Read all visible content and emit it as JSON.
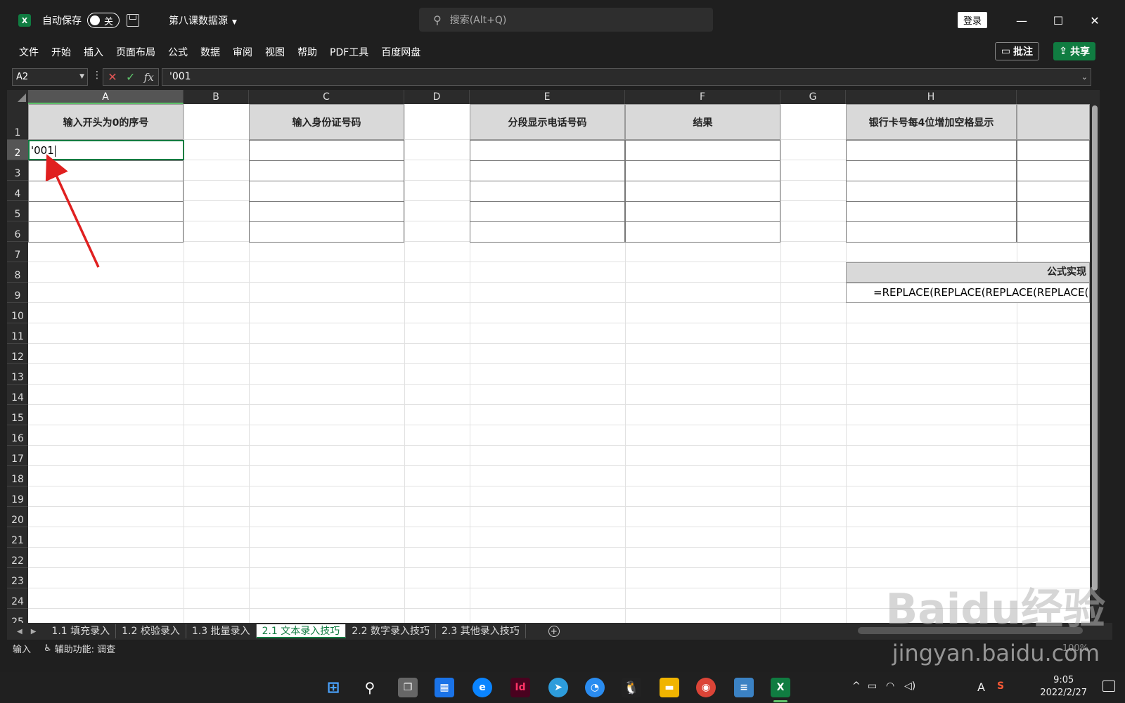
{
  "titlebar": {
    "autosave_label": "自动保存",
    "autosave_state": "关",
    "doc_name": "第八课数据源",
    "search_placeholder": "搜索(Alt+Q)",
    "login": "登录"
  },
  "menu": [
    "文件",
    "开始",
    "插入",
    "页面布局",
    "公式",
    "数据",
    "审阅",
    "视图",
    "帮助",
    "PDF工具",
    "百度网盘"
  ],
  "actions": {
    "comment": "批注",
    "share": "共享"
  },
  "formula_bar": {
    "name_box": "A2",
    "formula": "'001"
  },
  "columns": [
    "A",
    "B",
    "C",
    "D",
    "E",
    "F",
    "G",
    "H"
  ],
  "rows": [
    "1",
    "2",
    "3",
    "4",
    "5",
    "6",
    "7",
    "8",
    "9",
    "10",
    "11",
    "12",
    "13",
    "14",
    "15",
    "16",
    "17",
    "18",
    "19",
    "20",
    "21",
    "22",
    "23",
    "24",
    "25"
  ],
  "headers": {
    "a1": "输入开头为0的序号",
    "c1": "输入身份证号码",
    "e1": "分段显示电话号码",
    "f1": "结果",
    "h1": "银行卡号每4位增加空格显示"
  },
  "active_cell": {
    "value": "'001"
  },
  "formula_block": {
    "title": "公式实现",
    "formula": "=REPLACE(REPLACE(REPLACE(REPLACE("
  },
  "sheets": [
    "1.1 填充录入",
    "1.2 校验录入",
    "1.3 批量录入",
    "2.1 文本录入技巧",
    "2.2 数字录入技巧",
    "2.3 其他录入技巧"
  ],
  "active_sheet_index": 3,
  "status": {
    "mode": "输入",
    "accessibility": "辅助功能: 调查",
    "zoom": "100%"
  },
  "taskbar": {
    "time": "9:05",
    "date": "2022/2/27",
    "ime": "A"
  },
  "watermark": {
    "brand": "Baidu经验",
    "url": "jingyan.baidu.com"
  }
}
